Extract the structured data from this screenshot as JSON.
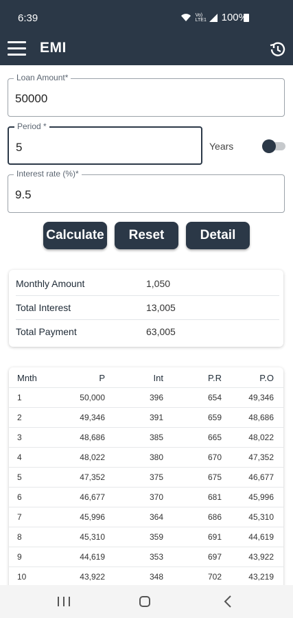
{
  "status": {
    "time": "6:39",
    "battery": "100%",
    "signal_text": "Vo) LTE1"
  },
  "appbar": {
    "title": "EMI"
  },
  "form": {
    "loan_label": "Loan Amount*",
    "loan_value": "50000",
    "period_label": "Period *",
    "period_value": "5",
    "years_label": "Years",
    "years_toggle": false,
    "interest_label": "Interest rate (%)*",
    "interest_value": "9.5"
  },
  "buttons": {
    "calculate": "Calculate",
    "reset": "Reset",
    "detail": "Detail"
  },
  "summary": [
    {
      "label": "Monthly Amount",
      "value": "1,050"
    },
    {
      "label": "Total Interest",
      "value": "13,005"
    },
    {
      "label": "Total Payment",
      "value": "63,005"
    }
  ],
  "table": {
    "headers": [
      "Mnth",
      "P",
      "Int",
      "P.R",
      "P.O"
    ],
    "rows": [
      [
        "1",
        "50,000",
        "396",
        "654",
        "49,346"
      ],
      [
        "2",
        "49,346",
        "391",
        "659",
        "48,686"
      ],
      [
        "3",
        "48,686",
        "385",
        "665",
        "48,022"
      ],
      [
        "4",
        "48,022",
        "380",
        "670",
        "47,352"
      ],
      [
        "5",
        "47,352",
        "375",
        "675",
        "46,677"
      ],
      [
        "6",
        "46,677",
        "370",
        "681",
        "45,996"
      ],
      [
        "7",
        "45,996",
        "364",
        "686",
        "45,310"
      ],
      [
        "8",
        "45,310",
        "359",
        "691",
        "44,619"
      ],
      [
        "9",
        "44,619",
        "353",
        "697",
        "43,922"
      ],
      [
        "10",
        "43,922",
        "348",
        "702",
        "43,219"
      ]
    ]
  },
  "colors": {
    "primary": "#2b3847",
    "background": "#ffffff"
  },
  "icons": {
    "menu": "hamburger-icon",
    "history": "history-icon",
    "wifi": "wifi-icon",
    "signal": "signal-icon",
    "battery": "battery-icon"
  }
}
